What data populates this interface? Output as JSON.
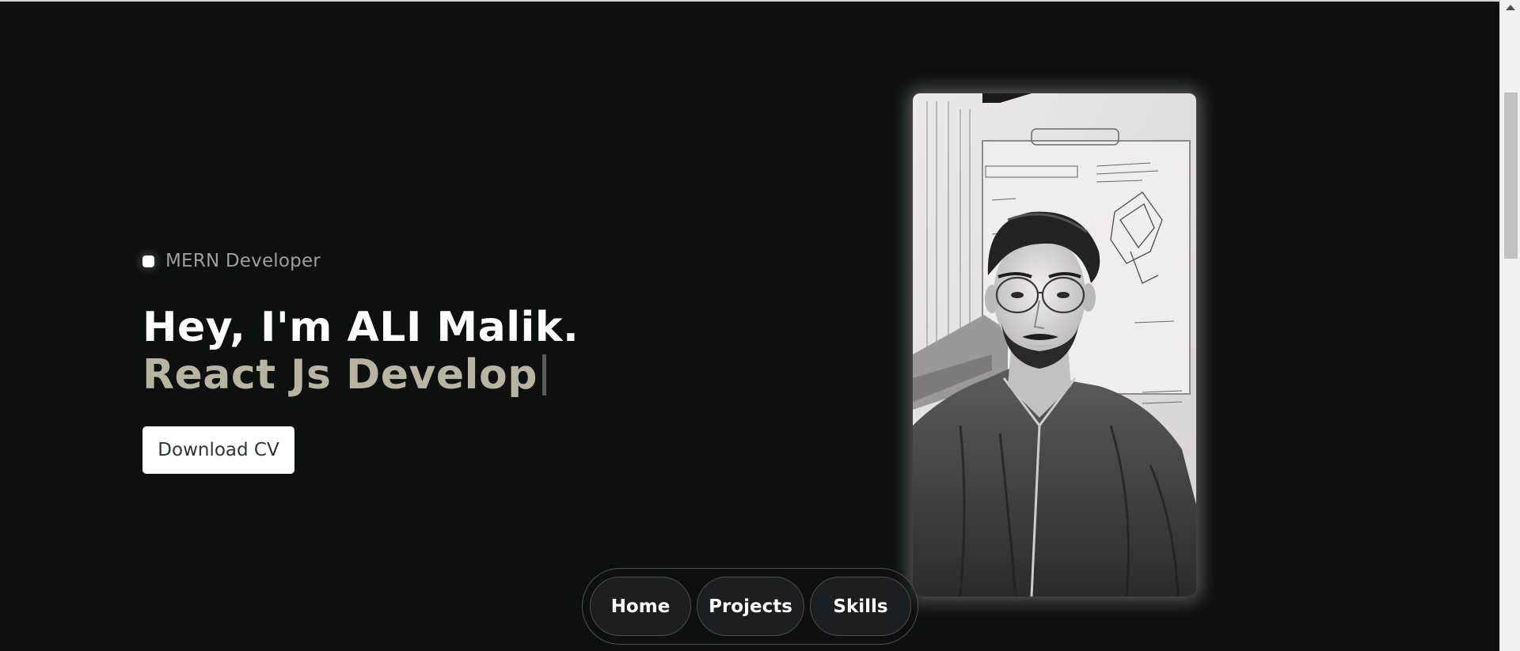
{
  "hero": {
    "role_label": "MERN Developer",
    "headline": "Hey, I'm ALI Malik.",
    "typed_text": "React Js Develop",
    "download_cv_label": "Download CV"
  },
  "nav": {
    "items": [
      {
        "label": "Home"
      },
      {
        "label": "Projects"
      },
      {
        "label": "Skills"
      }
    ]
  },
  "colors": {
    "background": "#0e1010",
    "headline": "#ffffff",
    "typed_text": "#b7b5a2",
    "role_label": "#9d9f98",
    "button_bg": "#ffffff"
  },
  "icons": {
    "role_indicator": "status-dot-icon",
    "portrait": "portrait-image",
    "scroll_up": "arrow-up-icon"
  }
}
